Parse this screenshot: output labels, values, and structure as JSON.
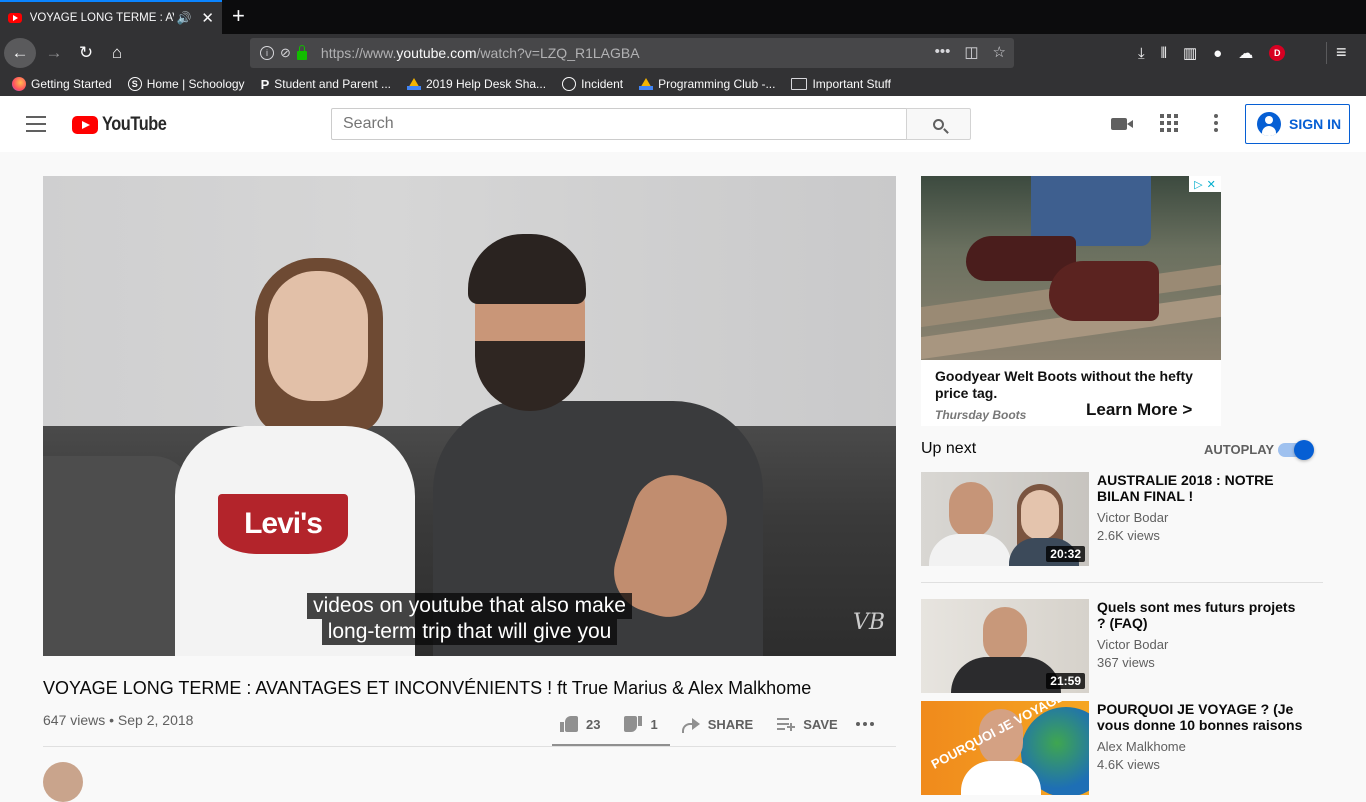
{
  "browser": {
    "tab_title": "VOYAGE LONG TERME : AVANTAGES ET INCONVÉNIENTS ! ft True Marius & Alex Malkhome - YouTube",
    "url_prefix": "https://www.",
    "url_domain": "youtube.com",
    "url_path": "/watch?v=LZQ_R1LAGBA",
    "profile_initial": "D",
    "bookmarks": [
      {
        "label": "Getting Started",
        "icon": "firefox-icon"
      },
      {
        "label": "Home | Schoology",
        "icon": "schoology-icon"
      },
      {
        "label": "Student and Parent ...",
        "icon": "p-icon"
      },
      {
        "label": "2019 Help Desk Sha...",
        "icon": "drive-icon"
      },
      {
        "label": "Incident",
        "icon": "globe-icon"
      },
      {
        "label": "Programming Club -...",
        "icon": "drive-icon"
      },
      {
        "label": "Important Stuff",
        "icon": "folder-icon"
      }
    ]
  },
  "masthead": {
    "logo_text": "YouTube",
    "search_placeholder": "Search",
    "signin_label": "SIGN IN"
  },
  "player": {
    "caption_line1": "videos on youtube that also make",
    "caption_line2": "long-term trip that will give you",
    "shirt_logo": "Levi's",
    "watermark": "VB"
  },
  "video": {
    "title": "VOYAGE LONG TERME : AVANTAGES ET INCONVÉNIENTS ! ft True Marius & Alex Malkhome",
    "meta": "647 views • Sep 2, 2018",
    "likes": "23",
    "dislikes": "1",
    "share_label": "SHARE",
    "save_label": "SAVE"
  },
  "ad": {
    "headline": "Goodyear Welt Boots without the hefty price tag.",
    "brand": "Thursday Boots",
    "cta": "Learn More >"
  },
  "sidebar": {
    "up_next_label": "Up next",
    "autoplay_label": "AUTOPLAY",
    "autoplay_on": true,
    "recommendations": [
      {
        "title": "AUSTRALIE 2018 : NOTRE BILAN FINAL !",
        "channel": "Victor Bodar",
        "views": "2.6K views",
        "duration": "20:32"
      },
      {
        "title": "Quels sont mes futurs projets ? (FAQ)",
        "channel": "Victor Bodar",
        "views": "367 views",
        "duration": "21:59"
      },
      {
        "title": "POURQUOI JE VOYAGE ? (Je vous donne 10 bonnes raisons",
        "channel": "Alex Malkhome",
        "views": "4.6K views",
        "duration": "",
        "thumb_text": "POURQUOI JE VOYAGE ?"
      }
    ]
  },
  "colors": {
    "youtube_red": "#ff0000",
    "link_blue": "#065fd4",
    "firefox_dark": "#323234"
  }
}
